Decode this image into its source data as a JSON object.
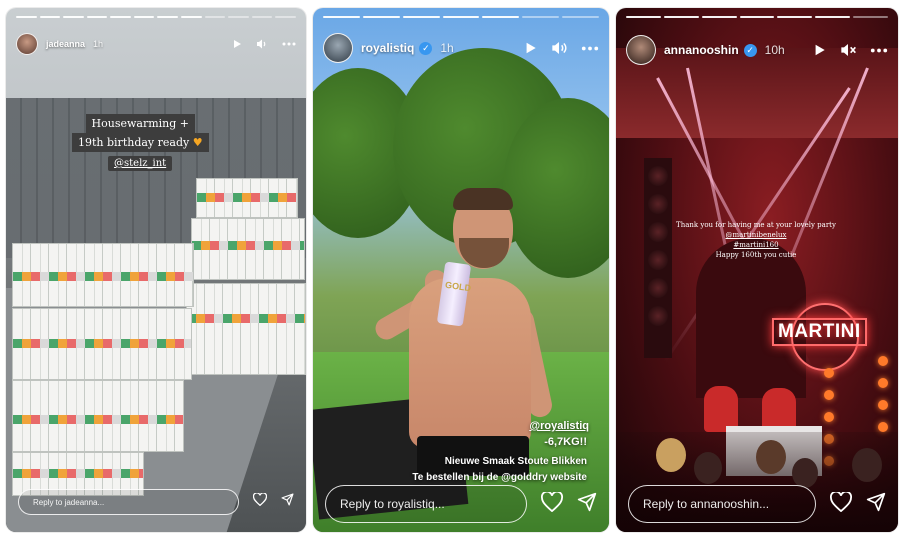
{
  "stories": [
    {
      "username": "jadeanna",
      "time": "1h",
      "verified": false,
      "caption_lines": [
        "Housewarming +",
        "19th birthday ready"
      ],
      "mention": "@stelz_int",
      "reply_placeholder": "Reply to jadeanna..."
    },
    {
      "username": "royalistiq",
      "time": "1h",
      "verified": true,
      "mention": "@royalistiq",
      "overlay_lines": [
        "-6,7KG!!",
        "Nieuwe Smaak Stoute Blikken",
        "Te bestellen bij de @golddry website"
      ],
      "can_label": "GOLD",
      "reply_placeholder": "Reply to royalistiq..."
    },
    {
      "username": "annanooshin",
      "time": "10h",
      "verified": true,
      "text_lines": [
        "Thank you for having me at your lovely party"
      ],
      "links": [
        "@martinibenelux",
        "#martini160"
      ],
      "closing_line": "Happy 160th you cutie",
      "sign": "MARTINI",
      "reply_placeholder": "Reply to annanooshin..."
    }
  ],
  "colors": {
    "verified": "#3897f0",
    "caption_bg": "#3d3d3d",
    "neon": "#ff4d4d"
  },
  "icons": [
    "play-icon",
    "speaker-icon",
    "speaker-muted-icon",
    "more-icon",
    "heart-icon",
    "send-icon"
  ]
}
